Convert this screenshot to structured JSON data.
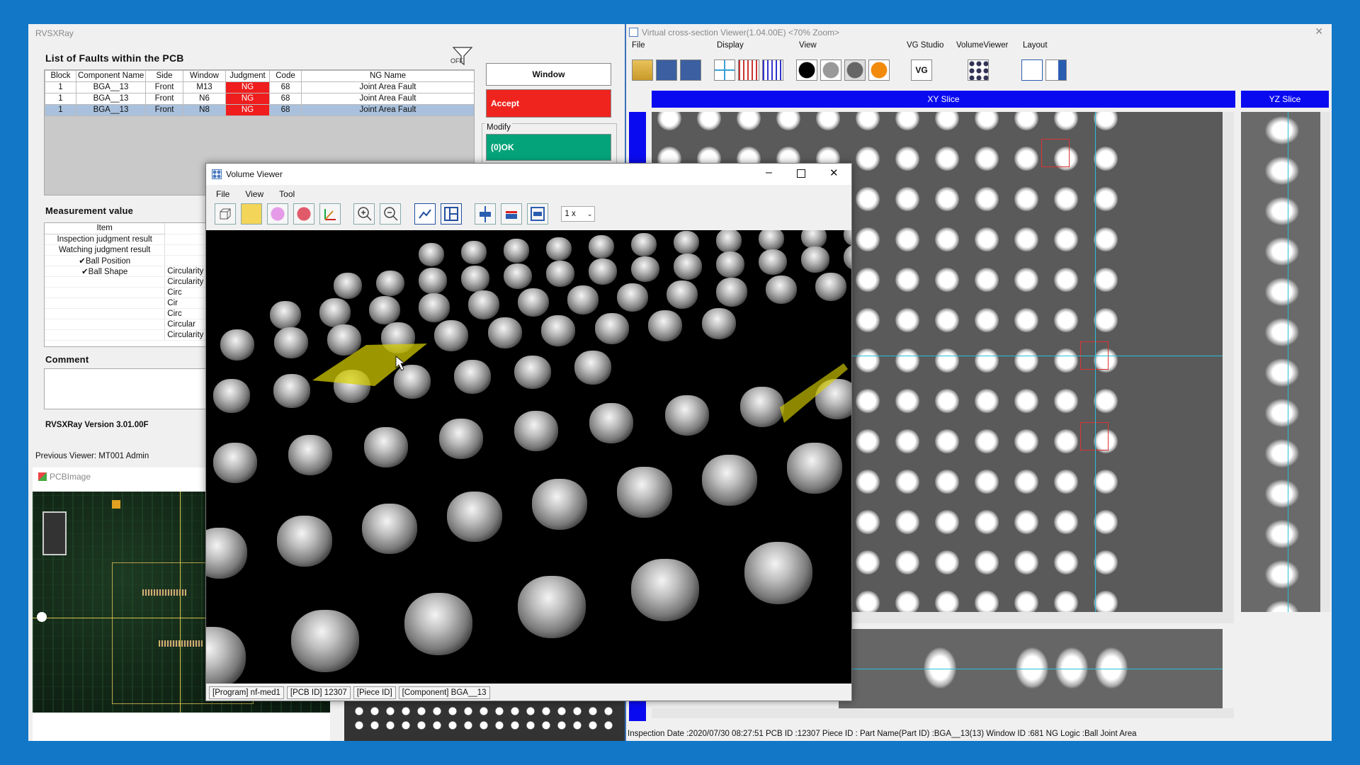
{
  "main": {
    "title": "RVSXRay",
    "fault_list_title": "List of Faults within the PCB",
    "filter_label": "OFF",
    "table": {
      "headers": [
        "Block",
        "Component Name",
        "Side",
        "Window",
        "Judgment",
        "Code",
        "NG Name"
      ],
      "rows": [
        [
          "1",
          "BGA__13",
          "Front",
          "M13",
          "NG",
          "68",
          "Joint Area Fault"
        ],
        [
          "1",
          "BGA__13",
          "Front",
          "N6",
          "NG",
          "68",
          "Joint Area Fault"
        ],
        [
          "1",
          "BGA__13",
          "Front",
          "N8",
          "NG",
          "68",
          "Joint Area Fault"
        ]
      ],
      "selected_row": 2
    },
    "window_button": "Window",
    "accept_button": "Accept",
    "modify_label": "Modify",
    "ok_button": "(0)OK",
    "measurement_title": "Measurement value",
    "measurement": {
      "header": "Item",
      "items": [
        {
          "item": "Inspection judgment result",
          "value": ""
        },
        {
          "item": "Watching judgment result",
          "value": ""
        },
        {
          "item": "✔Ball Position",
          "value": ""
        },
        {
          "item": "✔Ball Shape",
          "value": "Circularity"
        },
        {
          "item": "",
          "value": "Circularity"
        },
        {
          "item": "",
          "value": "Circ"
        },
        {
          "item": "",
          "value": "Cir"
        },
        {
          "item": "",
          "value": "Circ"
        },
        {
          "item": "",
          "value": "Circular"
        },
        {
          "item": "",
          "value": "Circularity"
        }
      ]
    },
    "comment_title": "Comment",
    "version": "RVSXRay Version 3.01.00F",
    "previous_viewer": "Previous Viewer: MT001 Admin"
  },
  "pcb_window": {
    "title": "PCBImage"
  },
  "cs_viewer": {
    "title": "Virtual cross-section Viewer(1.04.00E) <70% Zoom>",
    "groups": [
      "File",
      "Display",
      "View",
      "VG Studio",
      "VolumeViewer",
      "Layout"
    ],
    "vg_label": "VG",
    "xy_slice": "XY Slice",
    "yz_slice": "YZ Slice",
    "status": "Inspection Date :2020/07/30 08:27:51 PCB ID :12307 Piece ID : Part Name(Part ID) :BGA__13(13) Window ID :681 NG Logic :Ball Joint Area"
  },
  "volume_viewer": {
    "title": "Volume Viewer",
    "menu": [
      "File",
      "View",
      "Tool"
    ],
    "zoom": "1 x",
    "status": [
      "[Program] nf-med1",
      "[PCB ID] 12307",
      "[Piece ID]",
      "[Component] BGA__13"
    ]
  },
  "colors": {
    "accent": "#1177c6",
    "ng": "#ef1d1d",
    "accept": "#f0241e",
    "ok": "#05a37a",
    "slice_header": "#0a0af0"
  }
}
